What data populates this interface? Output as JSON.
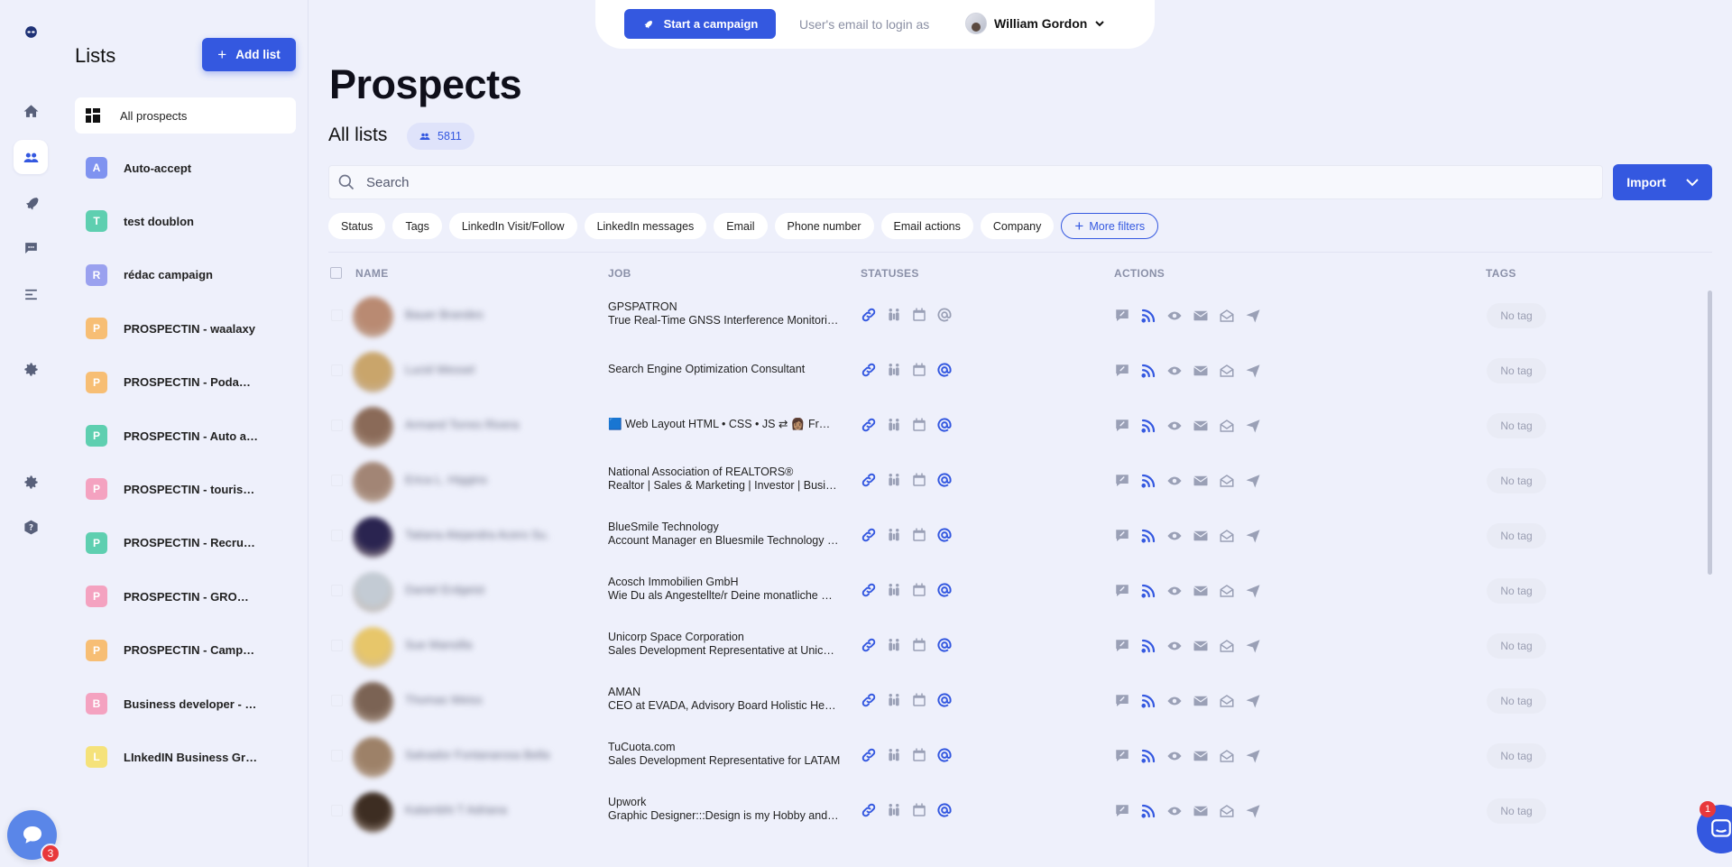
{
  "topbar": {
    "start_campaign_label": "Start a campaign",
    "login_as_label": "User's email to login as",
    "user_name": "William Gordon"
  },
  "lists_panel": {
    "title": "Lists",
    "add_list_label": "Add list",
    "all_prospects_label": "All prospects",
    "items": [
      {
        "letter": "A",
        "name": "Auto-accept",
        "color": "#7f93f0"
      },
      {
        "letter": "T",
        "name": "test doublon",
        "color": "#5ecfb0"
      },
      {
        "letter": "R",
        "name": "rédac campaign",
        "color": "#9aa1ef"
      },
      {
        "letter": "P",
        "name": "PROSPECTIN - waalaxy",
        "color": "#f7be74"
      },
      {
        "letter": "P",
        "name": "PROSPECTIN - Podaw…",
        "color": "#f7be74"
      },
      {
        "letter": "P",
        "name": "PROSPECTIN - Auto a…",
        "color": "#5ecfb0"
      },
      {
        "letter": "P",
        "name": "PROSPECTIN - tourisme",
        "color": "#f4a2c0"
      },
      {
        "letter": "P",
        "name": "PROSPECTIN - Recrut…",
        "color": "#5ecfb0"
      },
      {
        "letter": "P",
        "name": "PROSPECTIN - GROW…",
        "color": "#f4a2c0"
      },
      {
        "letter": "P",
        "name": "PROSPECTIN - Camp…",
        "color": "#f7be74"
      },
      {
        "letter": "B",
        "name": "Business developer - …",
        "color": "#f4a2c0"
      },
      {
        "letter": "L",
        "name": "LInkedIN Business Gr…",
        "color": "#f5e27a"
      }
    ]
  },
  "main": {
    "title": "Prospects",
    "subtitle": "All lists",
    "count": "5811",
    "search_placeholder": "Search",
    "import_label": "Import",
    "filters": [
      "Status",
      "Tags",
      "LinkedIn Visit/Follow",
      "LinkedIn messages",
      "Email",
      "Phone number",
      "Email actions",
      "Company"
    ],
    "more_filters_label": "More filters",
    "columns": {
      "name": "NAME",
      "job": "JOB",
      "statuses": "STATUSES",
      "actions": "ACTIONS",
      "tags": "TAGS"
    }
  },
  "rows": [
    {
      "name": "Bauer Brandes",
      "company": "GPSPATRON",
      "title": "True Real-Time GNSS Interference Monitori…",
      "tag": "No tag",
      "avatar": "#b98a72",
      "email_active": false
    },
    {
      "name": "Lucid Wessel",
      "company": "",
      "title": "Search Engine Optimization Consultant",
      "tag": "No tag",
      "avatar": "#c9a56b",
      "email_active": true
    },
    {
      "name": "Armand Torres Rivera",
      "company": "",
      "title": "🟦 Web Layout HTML • CSS • JS ⇄ 👩🏽 Fr…",
      "tag": "No tag",
      "avatar": "#8a6a58",
      "email_active": true
    },
    {
      "name": "Erica L. Higgins",
      "company": "National Association of REALTORS®",
      "title": "Realtor | Sales & Marketing | Investor | Busi…",
      "tag": "No tag",
      "avatar": "#a28575",
      "email_active": true
    },
    {
      "name": "Tatiana Alejandra Acero Su…",
      "company": "BlueSmile Technology",
      "title": "Account Manager en Bluesmile Technology …",
      "tag": "No tag",
      "avatar": "#2a2450",
      "email_active": true
    },
    {
      "name": "Daniel Erdgeist",
      "company": "Acosch Immobilien GmbH",
      "title": "Wie Du als Angestellte/r Deine monatliche …",
      "tag": "No tag",
      "avatar": "#c3cbd4",
      "email_active": true
    },
    {
      "name": "Sue Mansilla",
      "company": "Unicorp Space Corporation",
      "title": "Sales Development Representative at Unic…",
      "tag": "No tag",
      "avatar": "#e7c66a",
      "email_active": true
    },
    {
      "name": "Thomas Weiss",
      "company": "AMAN",
      "title": "CEO at EVADA, Advisory Board Holistic He…",
      "tag": "No tag",
      "avatar": "#7b6354",
      "email_active": true
    },
    {
      "name": "Salvador Fontanarosa Bella…",
      "company": "TuCuota.com",
      "title": "Sales Development Representative for LATAM",
      "tag": "No tag",
      "avatar": "#9d8168",
      "email_active": true
    },
    {
      "name": "Kalambhi T Adriana",
      "company": "Upwork",
      "title": "Graphic Designer:::Design is my Hobby and…",
      "tag": "No tag",
      "avatar": "#3d2d22",
      "email_active": true
    }
  ],
  "widgets": {
    "chat_badge": "1",
    "help_badge": "3"
  },
  "colors": {
    "accent": "#3458e0",
    "background": "#eef0fb"
  }
}
